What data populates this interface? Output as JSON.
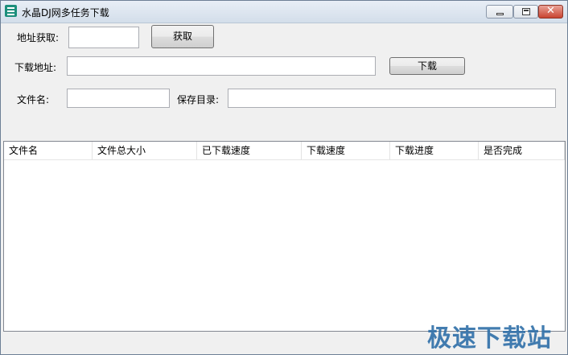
{
  "window": {
    "title": "水晶DJ网多任务下载",
    "controls": {
      "minimize": "minimize-icon",
      "maximize": "maximize-icon",
      "close": "close-icon"
    }
  },
  "form": {
    "fetch_label": "地址获取:",
    "fetch_value": "",
    "fetch_button": "获取",
    "download_url_label": "下载地址:",
    "download_url_value": "",
    "download_button": "下载",
    "filename_label": "文件名:",
    "filename_value": "",
    "save_dir_label": "保存目录:",
    "save_dir_value": ""
  },
  "list": {
    "columns": [
      "文件名",
      "文件总大小",
      "已下载速度",
      "下载速度",
      "下载进度",
      "是否完成"
    ],
    "rows": []
  },
  "watermark": "极速下载站",
  "colors": {
    "titlebar": "#d3deea",
    "close_button": "#c94431",
    "watermark": "#2f6fa8"
  }
}
